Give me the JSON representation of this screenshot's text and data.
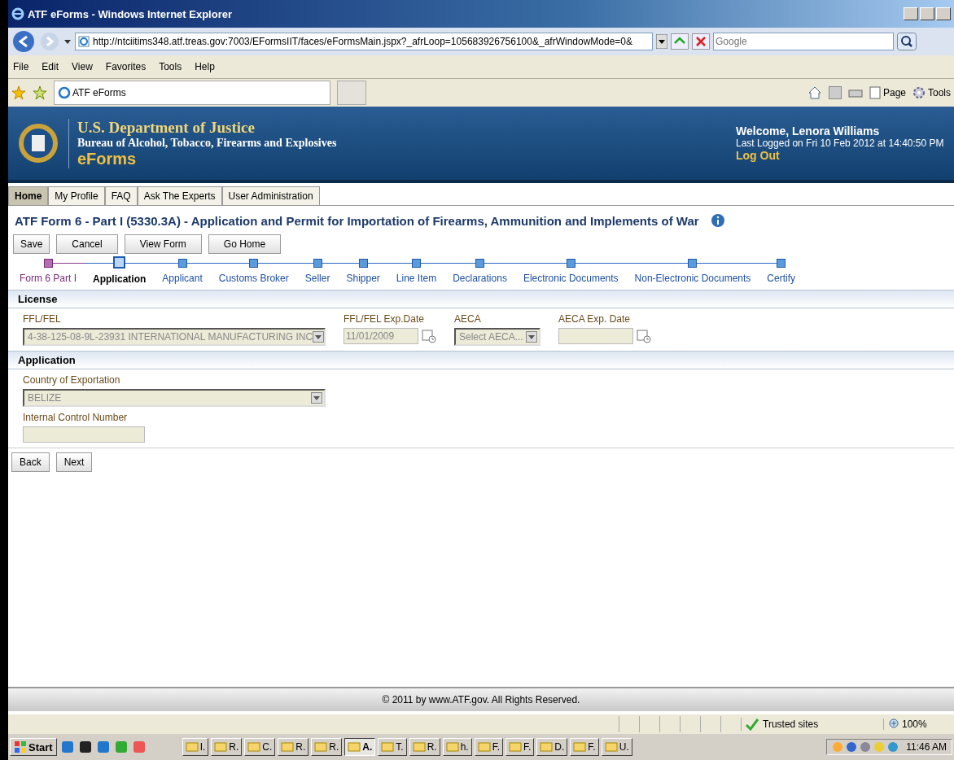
{
  "browser": {
    "title": "ATF eForms - Windows Internet Explorer",
    "address": "http://ntciitims348.atf.treas.gov:7003/EFormsIIT/faces/eFormsMain.jspx?_afrLoop=105683926756100&_afrWindowMode=0&",
    "search_placeholder": "Google",
    "menu": [
      "File",
      "Edit",
      "View",
      "Favorites",
      "Tools",
      "Help"
    ],
    "tab": "ATF eForms",
    "toolbar": [
      "Page",
      "Tools"
    ]
  },
  "banner": {
    "department": "U.S. Department of Justice",
    "bureau": "Bureau of Alcohol, Tobacco, Firearms and Explosives",
    "product": "eForms",
    "welcome": "Welcome, Lenora Williams",
    "last_logged": "Last Logged on Fri 10 Feb 2012 at 14:40:50 PM",
    "logout": "Log Out"
  },
  "nav_tabs": [
    {
      "label": "Home",
      "selected": true
    },
    {
      "label": "My Profile",
      "selected": false
    },
    {
      "label": "FAQ",
      "selected": false
    },
    {
      "label": "Ask The Experts",
      "selected": false
    },
    {
      "label": "User Administration",
      "selected": false
    }
  ],
  "form_title": "ATF Form 6 - Part I (5330.3A) - Application and Permit for Importation of Firearms, Ammunition and Implements of War",
  "actions": [
    "Save",
    "Cancel",
    "View Form",
    "Go Home"
  ],
  "train": [
    {
      "label": "Form 6 Part I",
      "visited": true,
      "selected": false
    },
    {
      "label": "Application",
      "visited": false,
      "selected": true
    },
    {
      "label": "Applicant",
      "visited": false,
      "selected": false
    },
    {
      "label": "Customs Broker",
      "visited": false,
      "selected": false
    },
    {
      "label": "Seller",
      "visited": false,
      "selected": false
    },
    {
      "label": "Shipper",
      "visited": false,
      "selected": false
    },
    {
      "label": "Line Item",
      "visited": false,
      "selected": false
    },
    {
      "label": "Declarations",
      "visited": false,
      "selected": false
    },
    {
      "label": "Electronic Documents",
      "visited": false,
      "selected": false
    },
    {
      "label": "Non-Electronic Documents",
      "visited": false,
      "selected": false
    },
    {
      "label": "Certify",
      "visited": false,
      "selected": false
    }
  ],
  "sections": [
    {
      "title": "License",
      "fields": [
        {
          "label": "FFL/FEL",
          "kind": "select",
          "value": "4-38-125-08-9L-23931 INTERNATIONAL MANUFACTURING INC"
        },
        {
          "label": "FFL/FEL Exp.Date",
          "kind": "date",
          "value": "11/01/2009"
        },
        {
          "label": "AECA",
          "kind": "select",
          "value": "Select AECA..."
        },
        {
          "label": "AECA Exp. Date",
          "kind": "date"
        }
      ]
    },
    {
      "title": "Application",
      "fields": [
        {
          "label": "Country of Exportation",
          "kind": "select",
          "value": "BELIZE"
        },
        {
          "label": "Internal Control Number",
          "kind": "text"
        }
      ]
    }
  ],
  "nav_buttons": [
    "Back",
    "Next"
  ],
  "footer": "© 2011 by www.ATF.gov. All Rights Reserved.",
  "status": {
    "zone": "Trusted sites",
    "zoom": "100%"
  },
  "taskbar": {
    "start": "Start",
    "items": [
      {
        "label": "I.",
        "selected": false
      },
      {
        "label": "R.",
        "selected": false
      },
      {
        "label": "C.",
        "selected": false
      },
      {
        "label": "R.",
        "selected": false
      },
      {
        "label": "R.",
        "selected": false
      },
      {
        "label": "A.",
        "selected": true
      },
      {
        "label": "T.",
        "selected": false
      },
      {
        "label": "R.",
        "selected": false
      },
      {
        "label": "h.",
        "selected": false
      },
      {
        "label": "F.",
        "selected": false
      },
      {
        "label": "F.",
        "selected": false
      },
      {
        "label": "D.",
        "selected": false
      },
      {
        "label": "F.",
        "selected": false
      },
      {
        "label": "U.",
        "selected": false
      }
    ],
    "clock": "11:46 AM"
  }
}
